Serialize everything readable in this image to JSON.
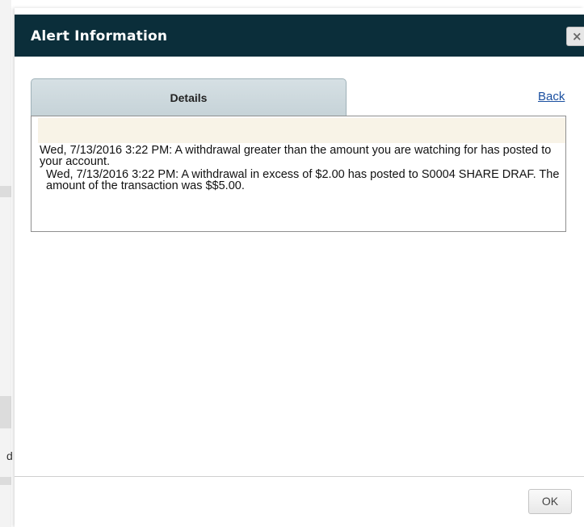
{
  "dialog": {
    "title": "Alert Information",
    "close_icon": "close-icon",
    "close_glyph": "×"
  },
  "tabs": {
    "details_label": "Details"
  },
  "nav": {
    "back_label": "Back"
  },
  "alert": {
    "message_1": "Wed, 7/13/2016 3:22 PM: A withdrawal greater than the amount you are watching for has posted to your account.",
    "message_2": "Wed, 7/13/2016 3:22 PM: A withdrawal in excess of $2.00 has posted to S0004 SHARE DRAF. The amount of the transaction was $$5.00."
  },
  "footer": {
    "ok_label": "OK"
  },
  "background": {
    "partial_letter": "d"
  },
  "colors": {
    "titlebar": "#0b2e3a",
    "link": "#1a4fa0",
    "panel_header": "#f8f3e7",
    "tab": "#c6d3d8"
  }
}
